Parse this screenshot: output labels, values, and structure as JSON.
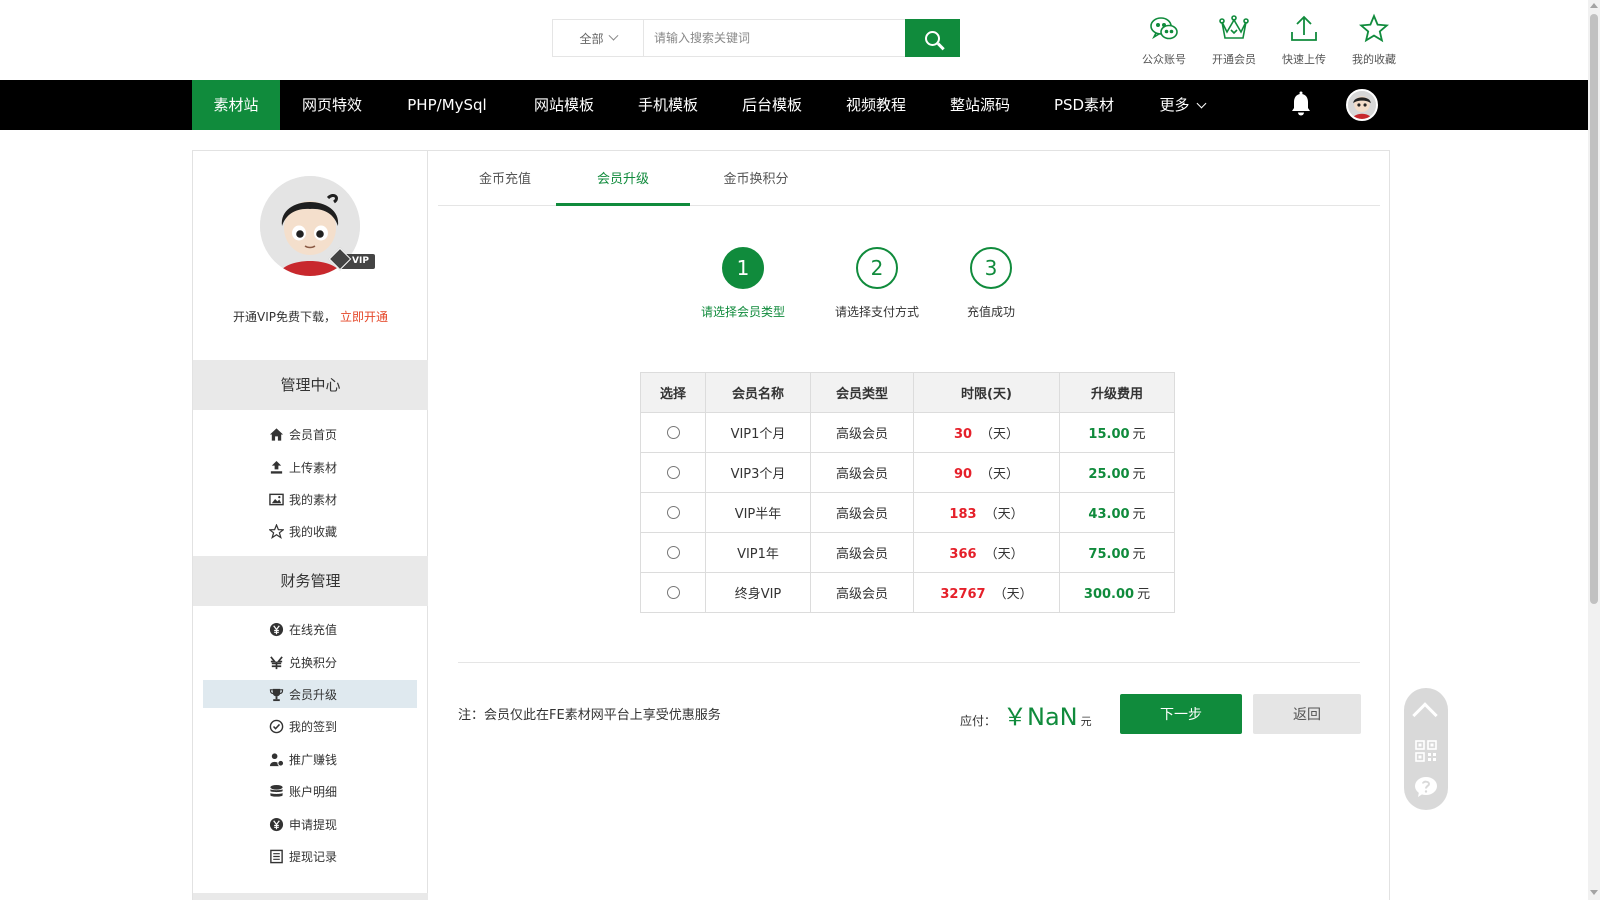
{
  "search": {
    "category": "全部",
    "placeholder": "请输入搜索关键词",
    "value": ""
  },
  "quick_links": [
    {
      "label": "公众账号",
      "icon": "wechat-icon"
    },
    {
      "label": "开通会员",
      "icon": "crown-icon"
    },
    {
      "label": "快速上传",
      "icon": "upload-icon"
    },
    {
      "label": "我的收藏",
      "icon": "star-icon"
    }
  ],
  "nav": {
    "items": [
      "素材站",
      "网页特效",
      "PHP/MySql",
      "网站模板",
      "手机模板",
      "后台模板",
      "视频教程",
      "整站源码",
      "PSD素材"
    ],
    "more": "更多",
    "active_index": 0
  },
  "sidebar": {
    "vip_badge": "VIP",
    "promo_text": "开通VIP免费下载，",
    "promo_link": "立即开通",
    "sections": [
      {
        "title": "管理中心",
        "items": [
          {
            "label": "会员首页",
            "icon": "home-icon"
          },
          {
            "label": "上传素材",
            "icon": "upload-icon"
          },
          {
            "label": "我的素材",
            "icon": "image-icon"
          },
          {
            "label": "我的收藏",
            "icon": "star-icon"
          }
        ]
      },
      {
        "title": "财务管理",
        "items": [
          {
            "label": "在线充值",
            "icon": "yen-icon"
          },
          {
            "label": "兑换积分",
            "icon": "exchange-icon"
          },
          {
            "label": "会员升级",
            "icon": "trophy-icon",
            "active": true
          },
          {
            "label": "我的签到",
            "icon": "check-circle-icon"
          },
          {
            "label": "推广赚钱",
            "icon": "user-coin-icon"
          },
          {
            "label": "账户明细",
            "icon": "database-icon"
          },
          {
            "label": "申请提现",
            "icon": "yen-icon"
          },
          {
            "label": "提现记录",
            "icon": "document-icon"
          }
        ]
      }
    ]
  },
  "tabs": [
    {
      "label": "金币充值"
    },
    {
      "label": "会员升级",
      "active": true
    },
    {
      "label": "金币换积分"
    }
  ],
  "steps": [
    {
      "num": "1",
      "label": "请选择会员类型",
      "active": true
    },
    {
      "num": "2",
      "label": "请选择支付方式"
    },
    {
      "num": "3",
      "label": "充值成功"
    }
  ],
  "table": {
    "headers": [
      "选择",
      "会员名称",
      "会员类型",
      "时限(天)",
      "升级费用"
    ],
    "day_unit": "（天）",
    "fee_unit": "元",
    "rows": [
      {
        "name": "VIP1个月",
        "type": "高级会员",
        "days": "30",
        "fee": "15.00"
      },
      {
        "name": "VIP3个月",
        "type": "高级会员",
        "days": "90",
        "fee": "25.00"
      },
      {
        "name": "VIP半年",
        "type": "高级会员",
        "days": "183",
        "fee": "43.00"
      },
      {
        "name": "VIP1年",
        "type": "高级会员",
        "days": "366",
        "fee": "75.00"
      },
      {
        "name": "终身VIP",
        "type": "高级会员",
        "days": "32767",
        "fee": "300.00"
      }
    ]
  },
  "footer": {
    "note": "注：会员仅此在FE素材网平台上享受优惠服务",
    "pay_label": "应付：",
    "pay_amount": "￥NaN",
    "pay_unit": "元",
    "next_label": "下一步",
    "back_label": "返回"
  },
  "colors": {
    "brand": "#108b3c",
    "highlight_red": "#e5202a",
    "promo_link": "#e5482a"
  }
}
